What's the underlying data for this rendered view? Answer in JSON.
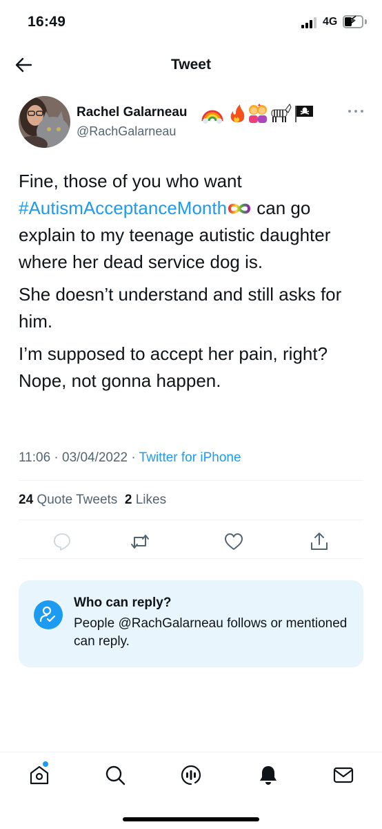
{
  "status_bar": {
    "time": "16:49",
    "network": "4G"
  },
  "header": {
    "title": "Tweet"
  },
  "tweet": {
    "author_name": "Rachel Galarneau",
    "author_emojis": "🌈 🔥👭🦓🏴‍☠️",
    "author_handle": "@RachGalarneau",
    "paragraph1_before": "Fine, those of you who want ",
    "hashtag": "#AutismAcceptanceMonth",
    "paragraph1_after": " can go explain to my teenage autistic daughter where her dead service dog is.",
    "paragraph2": "She doesn’t understand and still asks for him.",
    "paragraph3": "I’m supposed to accept her pain, right? Nope, not gonna happen.",
    "time": "11:06",
    "date": "03/04/2022",
    "source": "Twitter for iPhone",
    "quote_tweets_count": "24",
    "quote_tweets_label": "Quote Tweets",
    "likes_count": "2",
    "likes_label": "Likes"
  },
  "reply_restriction": {
    "title": "Who can reply?",
    "text": "People @RachGalarneau follows or mentioned can reply."
  },
  "icons": {
    "back": "arrow-left-icon",
    "more": "more-horizontal-icon",
    "reply": "reply-icon",
    "retweet": "retweet-icon",
    "like": "heart-icon",
    "share": "share-icon",
    "tabs": [
      "home-icon",
      "search-icon",
      "spaces-icon",
      "notifications-icon",
      "messages-icon"
    ]
  },
  "colors": {
    "accent": "#1d9bf0",
    "text": "#0f1419",
    "secondary": "#536471",
    "reply_box_bg": "#e8f5fd"
  }
}
